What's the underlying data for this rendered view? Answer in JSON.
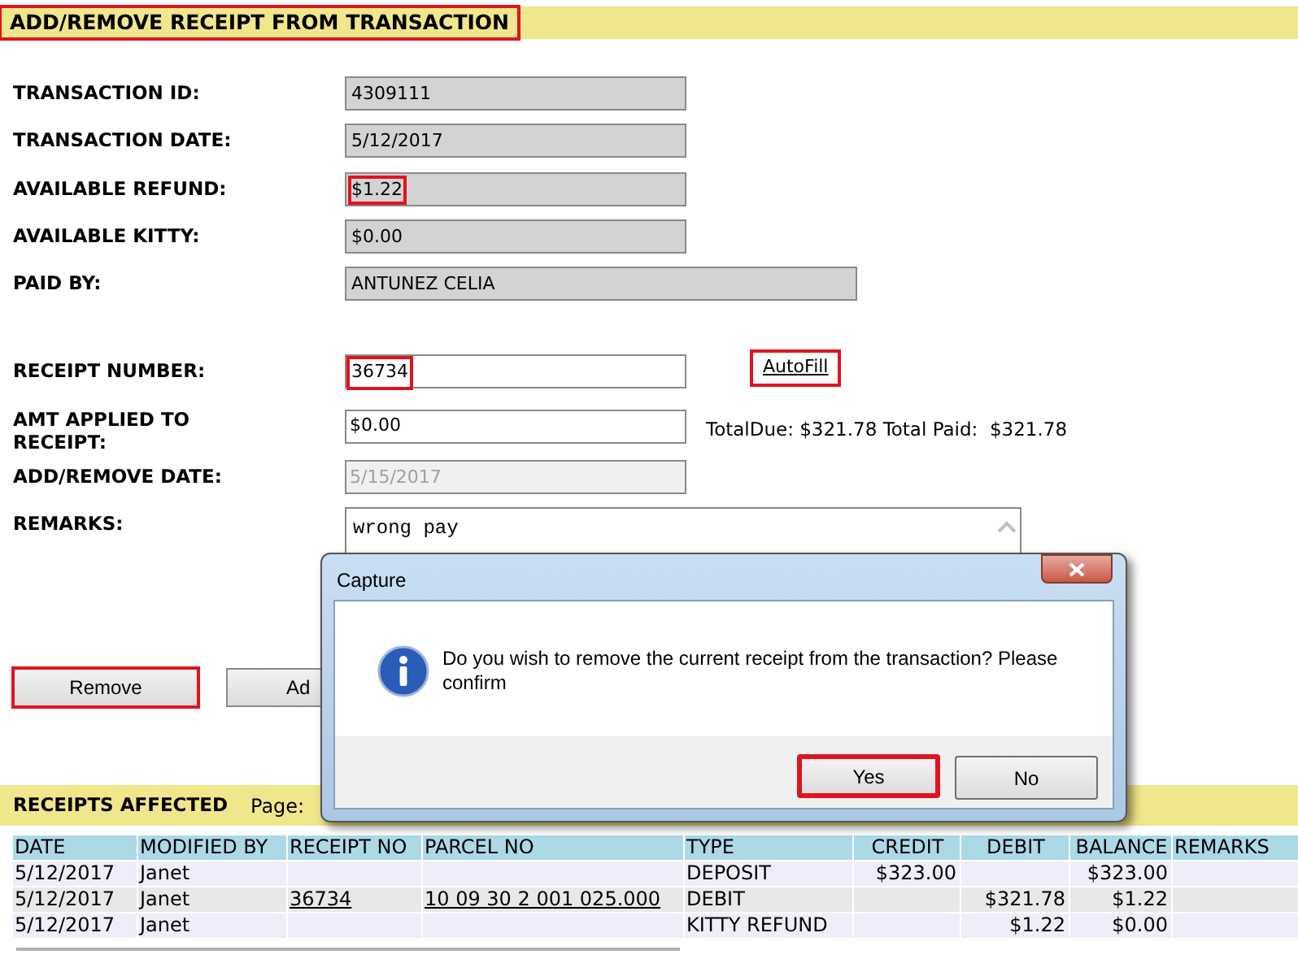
{
  "header": {
    "title": "ADD/REMOVE RECEIPT FROM TRANSACTION",
    "highlighted": true
  },
  "info_fields": [
    {
      "label": "TRANSACTION ID:",
      "value": "4309111",
      "highlighted": false,
      "wide": false
    },
    {
      "label": "TRANSACTION DATE:",
      "value": "5/12/2017",
      "highlighted": false,
      "wide": false
    },
    {
      "label": "AVAILABLE REFUND:",
      "value": "$1.22",
      "highlighted": true,
      "wide": false
    },
    {
      "label": "AVAILABLE KITTY:",
      "value": "$0.00",
      "highlighted": false,
      "wide": false
    },
    {
      "label": "PAID BY:",
      "value": "ANTUNEZ CELIA",
      "highlighted": false,
      "wide": true
    }
  ],
  "receipt_number": {
    "label": "RECEIPT NUMBER:",
    "value": "36734",
    "highlighted": true,
    "autofill": {
      "label": "AutoFill",
      "highlighted": true
    }
  },
  "amt_applied": {
    "label": "AMT APPLIED TO RECEIPT:",
    "value": "$0.00",
    "totals": "TotalDue: $321.78 Total Paid:  $321.78"
  },
  "add_remove_date": {
    "label": "ADD/REMOVE DATE:",
    "value": "5/15/2017",
    "disabled": true
  },
  "remarks": {
    "label": "REMARKS:",
    "value": "wrong pay"
  },
  "buttons": [
    {
      "label": "Remove",
      "highlighted": true
    },
    {
      "label": "Ad",
      "highlighted": false
    }
  ],
  "receipts_affected": {
    "title": "RECEIPTS AFFECTED",
    "page_label": "Page:",
    "table": {
      "columns": [
        "DATE",
        "MODIFIED BY",
        "RECEIPT NO",
        "PARCEL NO",
        "TYPE",
        "CREDIT",
        "DEBIT",
        "BALANCE",
        "REMARKS"
      ],
      "rows": [
        {
          "date": "5/12/2017",
          "modified_by": "Janet",
          "receipt_no": "",
          "parcel_no": "",
          "type": "DEPOSIT",
          "credit": "$323.00",
          "debit": "",
          "balance": "$323.00"
        },
        {
          "date": "5/12/2017",
          "modified_by": "Janet",
          "receipt_no": "36734",
          "parcel_no": "10 09 30 2 001 025.000",
          "type": "DEBIT",
          "credit": "",
          "debit": "$321.78",
          "balance": "$1.22"
        },
        {
          "date": "5/12/2017",
          "modified_by": "Janet",
          "receipt_no": "",
          "parcel_no": "",
          "type": "KITTY REFUND",
          "credit": "",
          "debit": "$1.22",
          "balance": "$0.00"
        }
      ]
    }
  },
  "dialog": {
    "title": "Capture",
    "message": "Do you wish to remove the current receipt from the transaction? Please confirm",
    "buttons": [
      {
        "label": "Yes",
        "highlighted": true
      },
      {
        "label": "No",
        "highlighted": false
      }
    ]
  }
}
